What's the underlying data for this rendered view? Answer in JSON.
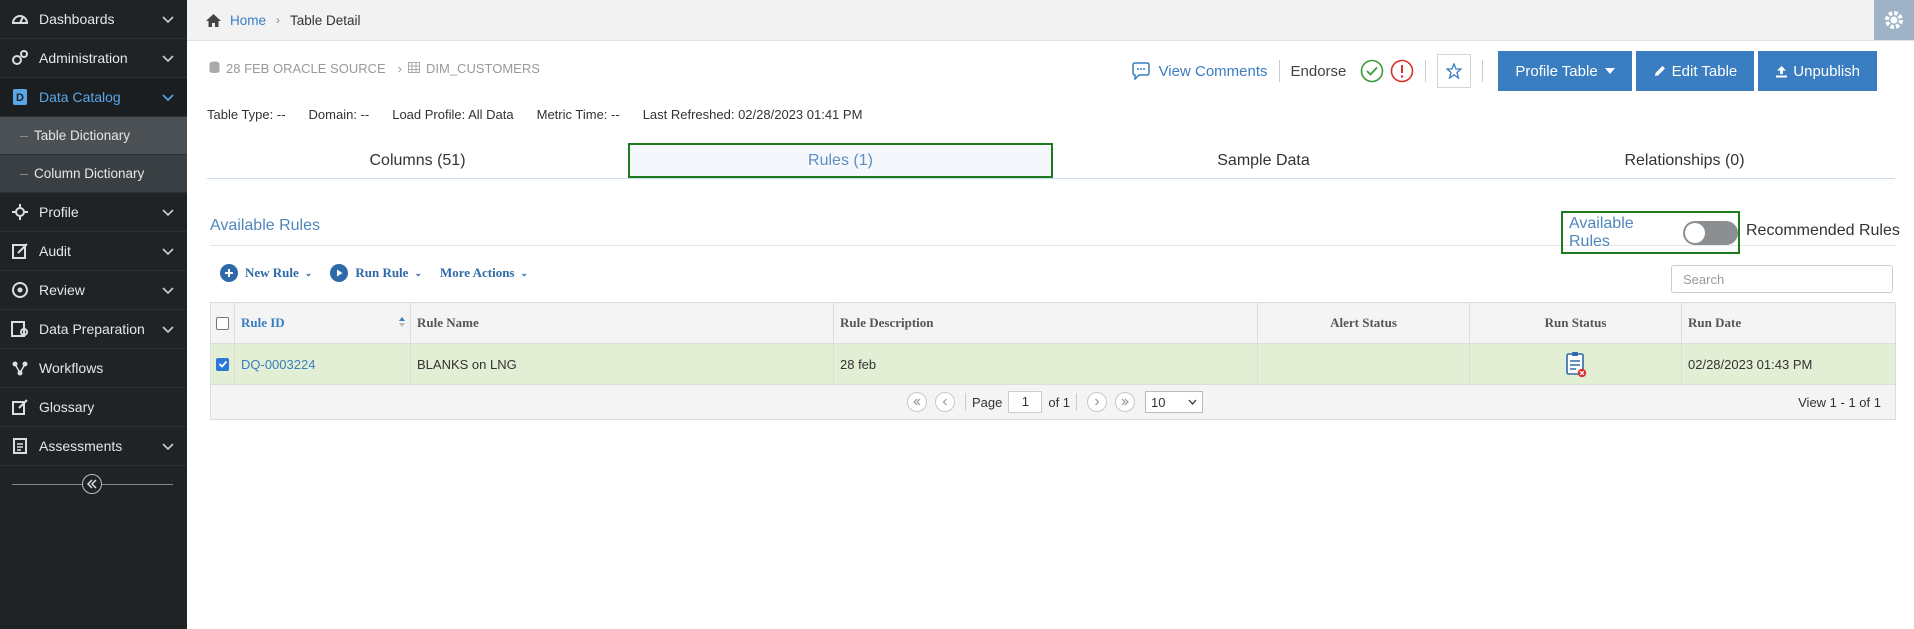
{
  "sidebar": {
    "items": [
      {
        "label": "Dashboards",
        "icon": "dashboard-icon",
        "expandable": true
      },
      {
        "label": "Administration",
        "icon": "gears-icon",
        "expandable": true
      },
      {
        "label": "Data Catalog",
        "icon": "catalog-icon",
        "expandable": true,
        "active": true
      },
      {
        "label": "Profile",
        "icon": "profile-icon",
        "expandable": true
      },
      {
        "label": "Audit",
        "icon": "audit-icon",
        "expandable": true
      },
      {
        "label": "Review",
        "icon": "review-icon",
        "expandable": true
      },
      {
        "label": "Data Preparation",
        "icon": "data-prep-icon",
        "expandable": true
      },
      {
        "label": "Workflows",
        "icon": "workflow-icon",
        "expandable": false
      },
      {
        "label": "Glossary",
        "icon": "glossary-icon",
        "expandable": false
      },
      {
        "label": "Assessments",
        "icon": "assessment-icon",
        "expandable": true
      }
    ],
    "subitems": [
      {
        "label": "Table Dictionary",
        "current": true
      },
      {
        "label": "Column Dictionary"
      }
    ]
  },
  "breadcrumb": {
    "home": "Home",
    "current": "Table Detail"
  },
  "source_path": {
    "source": "28 FEB ORACLE SOURCE",
    "table": "DIM_CUSTOMERS"
  },
  "actions": {
    "view_comments": "View Comments",
    "endorse": "Endorse",
    "profile_table": "Profile Table",
    "edit_table": "Edit Table",
    "unpublish": "Unpublish"
  },
  "meta": {
    "table_type": "Table Type: --",
    "domain": "Domain: --",
    "load_profile": "Load Profile: All Data",
    "metric_time": "Metric Time: --",
    "last_refreshed": "Last Refreshed: 02/28/2023 01:41 PM"
  },
  "tabs": [
    {
      "label": "Columns (51)"
    },
    {
      "label": "Rules (1)",
      "active": true
    },
    {
      "label": "Sample Data"
    },
    {
      "label": "Relationships (0)"
    }
  ],
  "section": {
    "title": "Available Rules",
    "toggle_left": "Available Rules",
    "toggle_right": "Recommended Rules"
  },
  "toolbar": {
    "new_rule": "New Rule",
    "run_rule": "Run Rule",
    "more_actions": "More Actions"
  },
  "search": {
    "placeholder": "Search"
  },
  "grid": {
    "columns": [
      "Rule ID",
      "Rule Name",
      "Rule Description",
      "Alert Status",
      "Run Status",
      "Run Date"
    ],
    "rows": [
      {
        "rule_id": "DQ-0003224",
        "rule_name": "BLANKS on LNG",
        "rule_description": "28 feb",
        "alert_status": "",
        "run_status": "run-failed-icon",
        "run_date": "02/28/2023 01:43 PM",
        "checked": true
      }
    ]
  },
  "pager": {
    "page_label": "Page",
    "page_value": "1",
    "of_label": "of 1",
    "page_size": "10",
    "view_count": "View 1 - 1 of 1"
  },
  "colors": {
    "sidebar_bg": "#1f2326",
    "accent_blue": "#3a7dc0",
    "highlight_green": "#1d7a1d",
    "selected_row": "#e3efd4"
  }
}
